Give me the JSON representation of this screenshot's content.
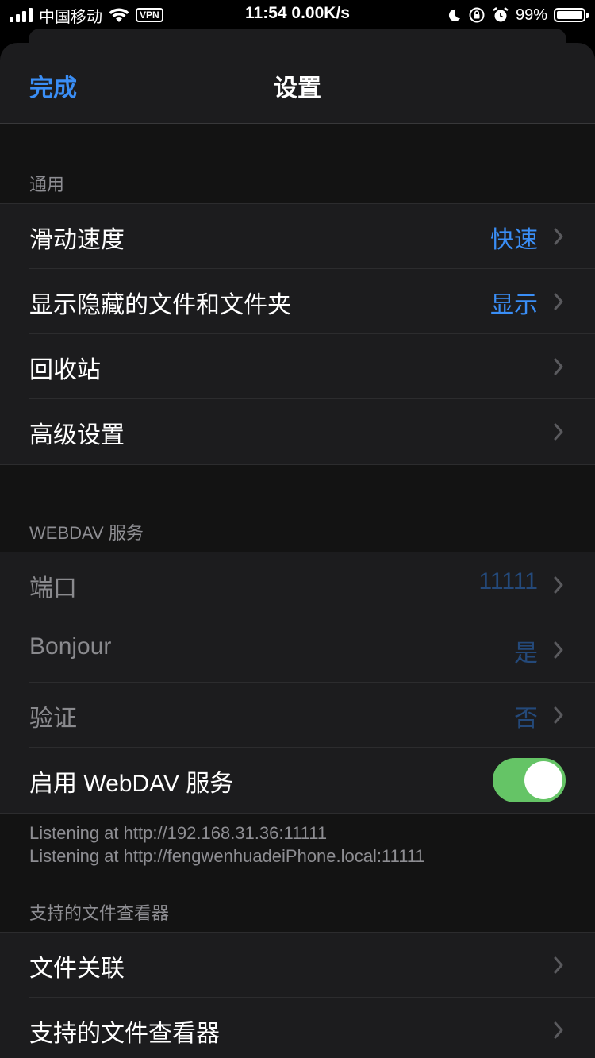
{
  "status_bar": {
    "carrier": "中国移动",
    "vpn": "VPN",
    "time": "11:54 0.00K/s",
    "battery_pct": "99%",
    "battery_level": 0.99
  },
  "nav": {
    "done": "完成",
    "title": "设置"
  },
  "sections": {
    "general": {
      "header": "通用",
      "rows": [
        {
          "label": "滑动速度",
          "value": "快速"
        },
        {
          "label": "显示隐藏的文件和文件夹",
          "value": "显示"
        },
        {
          "label": "回收站",
          "value": ""
        },
        {
          "label": "高级设置",
          "value": ""
        }
      ]
    },
    "webdav": {
      "header": "WEBDAV 服务",
      "rows": [
        {
          "label": "端口",
          "value": "11111"
        },
        {
          "label": "Bonjour",
          "value": "是"
        },
        {
          "label": "验证",
          "value": "否"
        }
      ],
      "toggle_row": {
        "label": "启用 WebDAV 服务",
        "on": true
      },
      "footer": [
        "Listening at http://192.168.31.36:11111",
        "Listening at http://fengwenhuadeiPhone.local:11111"
      ]
    },
    "viewers": {
      "header": "支持的文件查看器",
      "rows": [
        {
          "label": "文件关联",
          "value": ""
        },
        {
          "label": "支持的文件查看器",
          "value": ""
        }
      ]
    }
  },
  "colors": {
    "accent": "#3a8ef6",
    "toggle_on": "#65c466"
  }
}
